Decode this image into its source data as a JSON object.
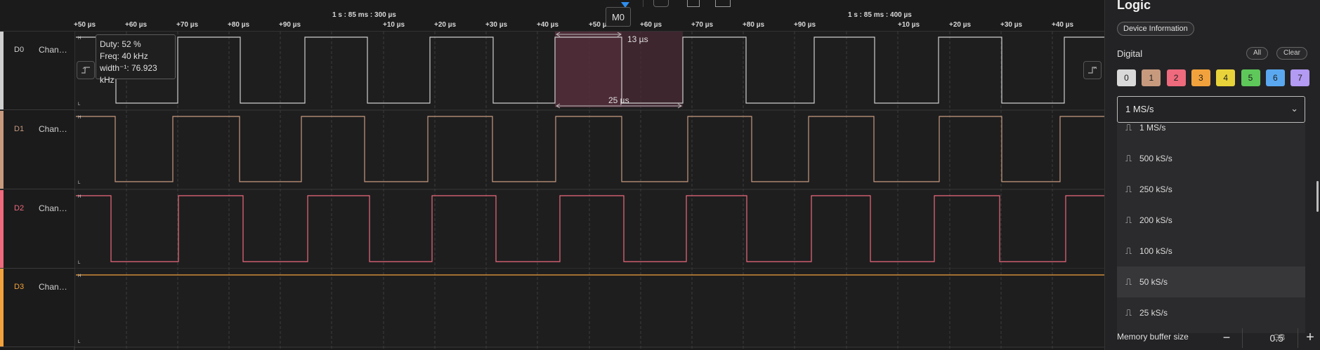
{
  "timeline": {
    "ref_left": "1 s : 85 ms : 300 µs",
    "ref_right": "1 s : 85 ms : 400 µs",
    "ticks": [
      "+50 µs",
      "+60 µs",
      "+70 µs",
      "+80 µs",
      "+90 µs",
      "+10 µs",
      "+20 µs",
      "+30 µs",
      "+40 µs",
      "+50 µs",
      "+60 µs",
      "+70 µs",
      "+80 µs",
      "+90 µs",
      "+10 µs",
      "+20 µs",
      "+30 µs",
      "+40 µs"
    ]
  },
  "channels": [
    {
      "id": "D0",
      "name": "Chan…",
      "color": "#cfcfcf"
    },
    {
      "id": "D1",
      "name": "Chan…",
      "color": "#c79a7e"
    },
    {
      "id": "D2",
      "name": "Chan…",
      "color": "#ee6a7c"
    },
    {
      "id": "D3",
      "name": "Chan…",
      "color": "#f2a23c"
    }
  ],
  "level_labels": {
    "high": "H",
    "low": "L"
  },
  "tooltip": {
    "duty": "Duty: 52 %",
    "freq": "Freq: 40 kHz",
    "width": "width⁻¹: 76.923 kHz"
  },
  "measurements": {
    "width_label": "13 µs",
    "period_label": "25 µs"
  },
  "marker": {
    "label": "M0"
  },
  "icons": {
    "play": "play-icon",
    "trigger_left": "falling-edge-icon",
    "trigger_right": "rising-edge-icon"
  },
  "panel": {
    "title": "Logic",
    "device_info": "Device Information",
    "digital_label": "Digital",
    "all_label": "All",
    "clear_label": "Clear",
    "channel_chips": [
      {
        "label": "0",
        "color": "#d9d9d9"
      },
      {
        "label": "1",
        "color": "#c79a7e"
      },
      {
        "label": "2",
        "color": "#ee6a7c"
      },
      {
        "label": "3",
        "color": "#f2a23c"
      },
      {
        "label": "4",
        "color": "#e8d43a"
      },
      {
        "label": "5",
        "color": "#5fc85a"
      },
      {
        "label": "6",
        "color": "#5aa8f0"
      },
      {
        "label": "7",
        "color": "#b39af2"
      }
    ],
    "sample_rate": {
      "selected": "1 MS/s",
      "options": [
        {
          "label": "1 MS/s",
          "checked": true
        },
        {
          "label": "500 kS/s",
          "checked": false
        },
        {
          "label": "250 kS/s",
          "checked": false
        },
        {
          "label": "200 kS/s",
          "checked": false
        },
        {
          "label": "100 kS/s",
          "checked": false
        },
        {
          "label": "50 kS/s",
          "checked": false,
          "hover": true
        },
        {
          "label": "25 kS/s",
          "checked": false
        }
      ]
    },
    "memory": {
      "label": "Memory buffer size",
      "value": "0.5",
      "unit": "GB",
      "minus": "−",
      "plus": "+"
    }
  }
}
